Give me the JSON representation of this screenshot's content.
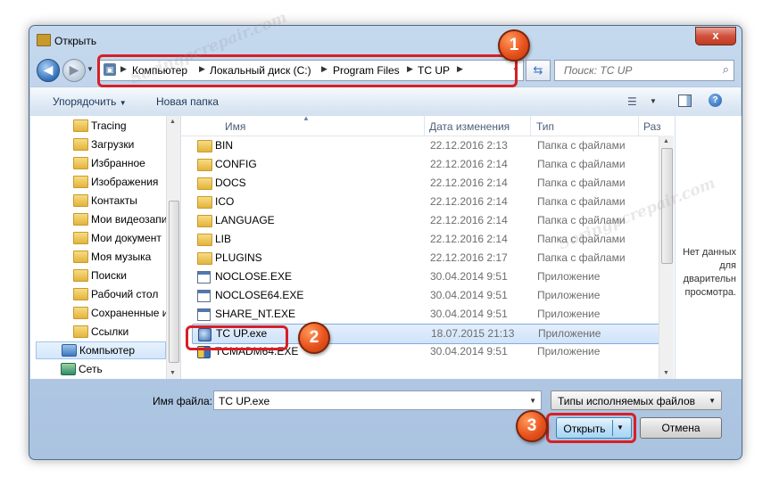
{
  "window": {
    "title": "Открыть",
    "close_glyph": "x"
  },
  "nav": {
    "back_glyph": "◀",
    "forward_glyph": "▶",
    "breadcrumbs": [
      "Компьютер",
      "Локальный диск (C:)",
      "Program Files",
      "TC UP"
    ],
    "refresh_glyph": "⇆",
    "search_placeholder": "Поиск: TC UP"
  },
  "toolbar": {
    "organize_label": "Упорядочить",
    "new_folder_label": "Новая папка",
    "help_glyph": "?"
  },
  "sidebar": {
    "items": [
      {
        "label": "Tracing",
        "icon": "folder-icon"
      },
      {
        "label": "Загрузки",
        "icon": "folder-icon"
      },
      {
        "label": "Избранное",
        "icon": "folder-icon"
      },
      {
        "label": "Изображения",
        "icon": "folder-icon"
      },
      {
        "label": "Контакты",
        "icon": "folder-icon"
      },
      {
        "label": "Мои видеозапи",
        "icon": "folder-icon"
      },
      {
        "label": "Мои документ",
        "icon": "folder-icon"
      },
      {
        "label": "Моя музыка",
        "icon": "folder-icon"
      },
      {
        "label": "Поиски",
        "icon": "folder-icon"
      },
      {
        "label": "Рабочий стол",
        "icon": "folder-icon"
      },
      {
        "label": "Сохраненные и",
        "icon": "folder-icon"
      },
      {
        "label": "Ссылки",
        "icon": "folder-icon"
      },
      {
        "label": "Компьютер",
        "icon": "computer-icon"
      },
      {
        "label": "Сеть",
        "icon": "network-icon"
      }
    ]
  },
  "columns": {
    "name": "Имя",
    "date": "Дата изменения",
    "type": "Тип",
    "size": "Раз"
  },
  "files": [
    {
      "name": "BIN",
      "date": "22.12.2016 2:13",
      "type": "Папка с файлами",
      "kind": "folder"
    },
    {
      "name": "CONFIG",
      "date": "22.12.2016 2:14",
      "type": "Папка с файлами",
      "kind": "folder"
    },
    {
      "name": "DOCS",
      "date": "22.12.2016 2:14",
      "type": "Папка с файлами",
      "kind": "folder"
    },
    {
      "name": "ICO",
      "date": "22.12.2016 2:14",
      "type": "Папка с файлами",
      "kind": "folder"
    },
    {
      "name": "LANGUAGE",
      "date": "22.12.2016 2:14",
      "type": "Папка с файлами",
      "kind": "folder"
    },
    {
      "name": "LIB",
      "date": "22.12.2016 2:14",
      "type": "Папка с файлами",
      "kind": "folder"
    },
    {
      "name": "PLUGINS",
      "date": "22.12.2016 2:17",
      "type": "Папка с файлами",
      "kind": "folder"
    },
    {
      "name": "NOCLOSE.EXE",
      "date": "30.04.2014 9:51",
      "type": "Приложение",
      "kind": "exe"
    },
    {
      "name": "NOCLOSE64.EXE",
      "date": "30.04.2014 9:51",
      "type": "Приложение",
      "kind": "exe"
    },
    {
      "name": "SHARE_NT.EXE",
      "date": "30.04.2014 9:51",
      "type": "Приложение",
      "kind": "exe"
    },
    {
      "name": "TC UP.exe",
      "date": "18.07.2015 21:13",
      "type": "Приложение",
      "kind": "tc",
      "selected": true
    },
    {
      "name": "TCMADM64.EXE",
      "date": "30.04.2014 9:51",
      "type": "Приложение",
      "kind": "tcm"
    }
  ],
  "preview": {
    "line1": "Нет данных",
    "line2": "для",
    "line3": "дварительн",
    "line4": "просмотра."
  },
  "footer": {
    "filename_label": "Имя файла:",
    "filename_value": "TC UP.exe",
    "filter_value": "Типы исполняемых файлов",
    "open_label": "Открыть",
    "cancel_label": "Отмена"
  },
  "callouts": {
    "one": "1",
    "two": "2",
    "three": "3"
  },
  "watermark_text": "Soringpcrepair.com",
  "colors": {
    "callout_red": "#d71f26",
    "badge_orange": "#e8521d",
    "selection_blue": "#cfe3fa"
  }
}
